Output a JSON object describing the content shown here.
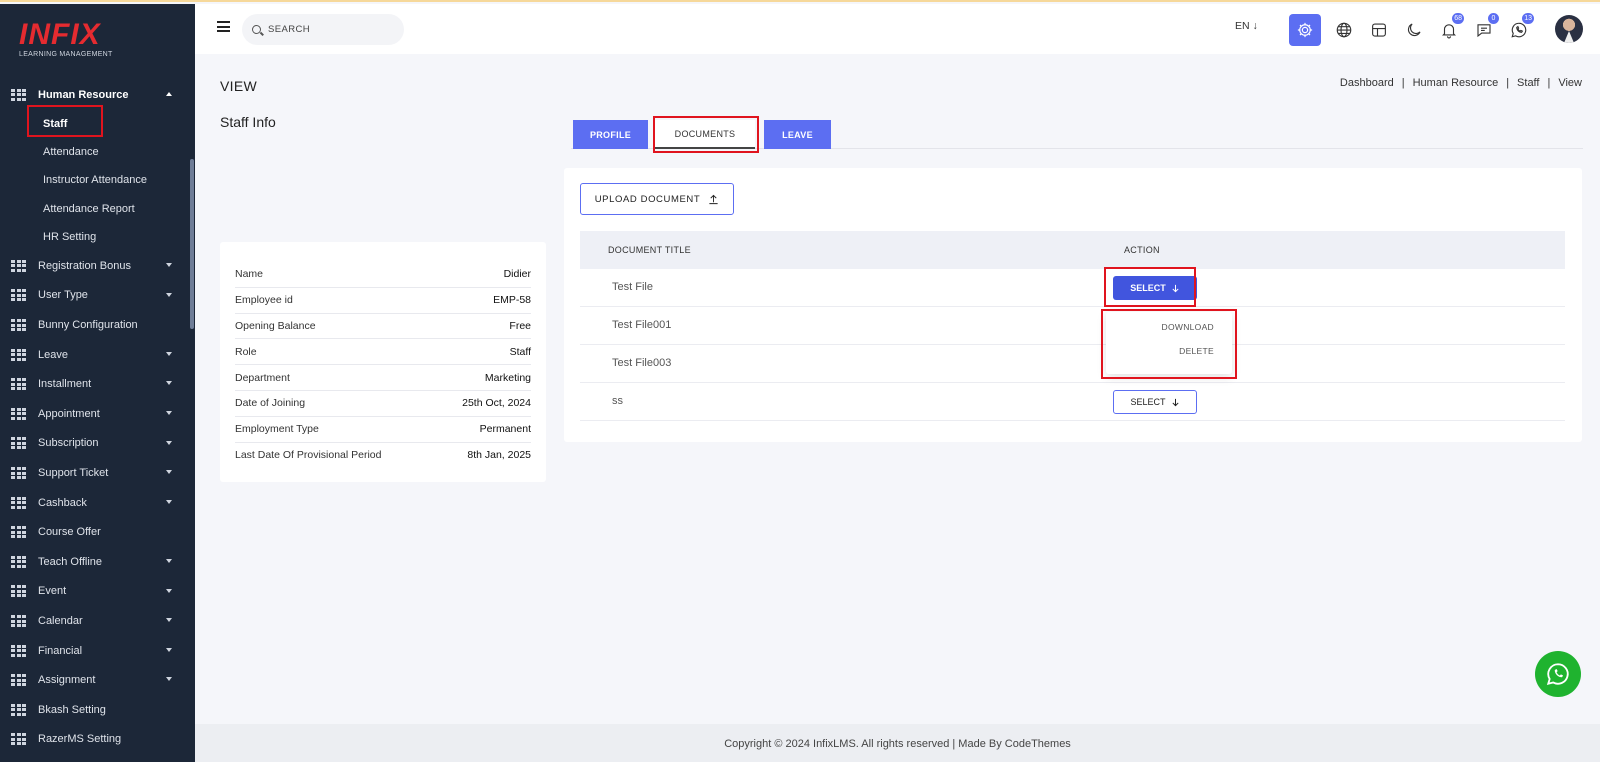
{
  "brand": {
    "logo_text": "INFIX",
    "logo_sub": "LEARNING MANAGEMENT"
  },
  "sidebar": {
    "group": {
      "label": "Human Resource"
    },
    "sub_items": [
      {
        "label": "Staff"
      },
      {
        "label": "Attendance"
      },
      {
        "label": "Instructor Attendance"
      },
      {
        "label": "Attendance Report"
      },
      {
        "label": "HR Setting"
      }
    ],
    "items": [
      {
        "label": "Registration Bonus"
      },
      {
        "label": "User Type"
      },
      {
        "label": "Bunny Configuration"
      },
      {
        "label": "Leave"
      },
      {
        "label": "Installment"
      },
      {
        "label": "Appointment"
      },
      {
        "label": "Subscription"
      },
      {
        "label": "Support Ticket"
      },
      {
        "label": "Cashback"
      },
      {
        "label": "Course Offer"
      },
      {
        "label": "Teach Offline"
      },
      {
        "label": "Event"
      },
      {
        "label": "Calendar"
      },
      {
        "label": "Financial"
      },
      {
        "label": "Assignment"
      },
      {
        "label": "Bkash Setting"
      },
      {
        "label": "RazerMS Setting"
      }
    ]
  },
  "topbar": {
    "search_placeholder": "SEARCH",
    "language": "EN ↓",
    "notifications_count": "68",
    "messages_count": "0",
    "whatsapp_count": "13"
  },
  "page": {
    "title": "VIEW",
    "breadcrumb": [
      "Dashboard",
      "Human Resource",
      "Staff",
      "View"
    ],
    "section_title": "Staff Info"
  },
  "staff_info": [
    {
      "label": "Name",
      "value": "Didier"
    },
    {
      "label": "Employee id",
      "value": "EMP-58"
    },
    {
      "label": "Opening Balance",
      "value": "Free"
    },
    {
      "label": "Role",
      "value": "Staff"
    },
    {
      "label": "Department",
      "value": "Marketing"
    },
    {
      "label": "Date of Joining",
      "value": "25th Oct, 2024"
    },
    {
      "label": "Employment Type",
      "value": "Permanent"
    },
    {
      "label": "Last Date Of Provisional Period",
      "value": "8th Jan, 2025"
    }
  ],
  "tabs": [
    {
      "label": "PROFILE"
    },
    {
      "label": "DOCUMENTS"
    },
    {
      "label": "LEAVE"
    }
  ],
  "documents": {
    "upload_label": "UPLOAD DOCUMENT",
    "columns": [
      "DOCUMENT TITLE",
      "ACTION"
    ],
    "rows": [
      {
        "title": "Test File",
        "action": "SELECT"
      },
      {
        "title": "Test File001",
        "action": ""
      },
      {
        "title": "Test File003",
        "action": ""
      },
      {
        "title": "ss",
        "action": "SELECT"
      }
    ],
    "dropdown": [
      "DOWNLOAD",
      "DELETE"
    ]
  },
  "footer": {
    "text": "Copyright © 2024 InfixLMS. All rights reserved | Made By CodeThemes"
  },
  "colors": {
    "sidebar_bg": "#1c2738",
    "accent": "#5c6ef2",
    "highlight": "#e0141e",
    "whatsapp": "#1fb32f"
  }
}
